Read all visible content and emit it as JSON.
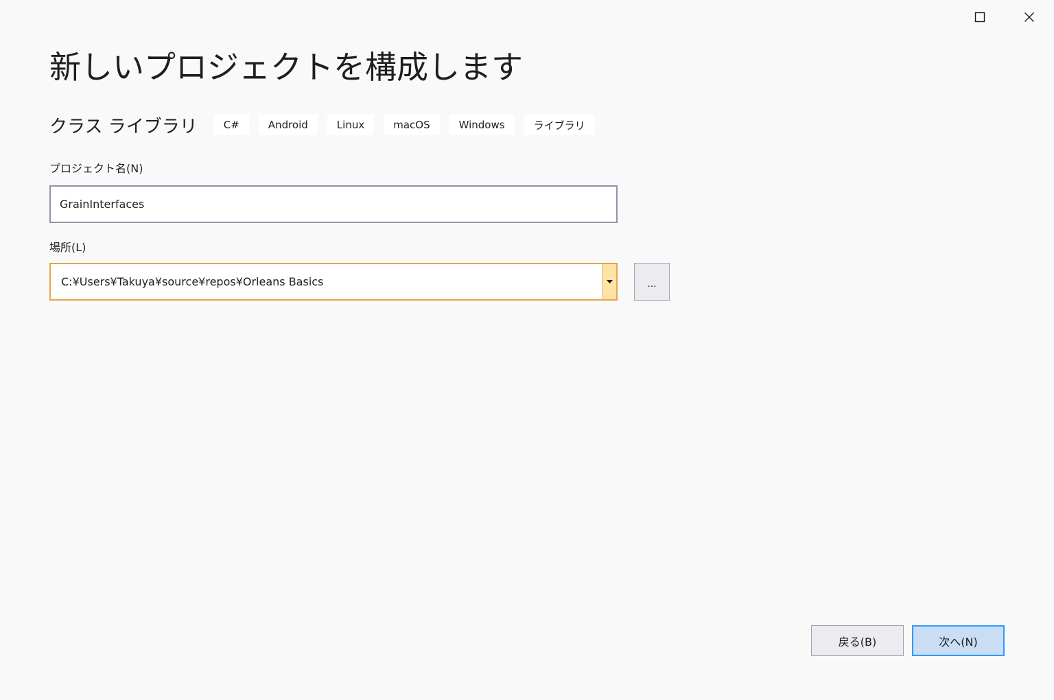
{
  "window": {
    "maximize_icon": "maximize-icon",
    "close_icon": "close-icon"
  },
  "page": {
    "title": "新しいプロジェクトを構成します"
  },
  "template": {
    "name": "クラス ライブラリ",
    "tags": [
      "C#",
      "Android",
      "Linux",
      "macOS",
      "Windows",
      "ライブラリ"
    ]
  },
  "project_name": {
    "label": "プロジェクト名(N)",
    "value": "GrainInterfaces"
  },
  "location": {
    "label": "場所(L)",
    "value": "C:¥Users¥Takuya¥source¥repos¥Orleans Basics",
    "dropdown_icon": "caret-down-icon",
    "browse_label": "..."
  },
  "footer": {
    "back_label": "戻る(B)",
    "next_label": "次へ(N)"
  },
  "colors": {
    "background": "#f9f9f9",
    "input_border": "#8d95a8",
    "focus_border": "#e5a64b",
    "dropdown_fill": "#ffe2a6",
    "primary_button": "#c9def5",
    "primary_border": "#3399ff"
  }
}
